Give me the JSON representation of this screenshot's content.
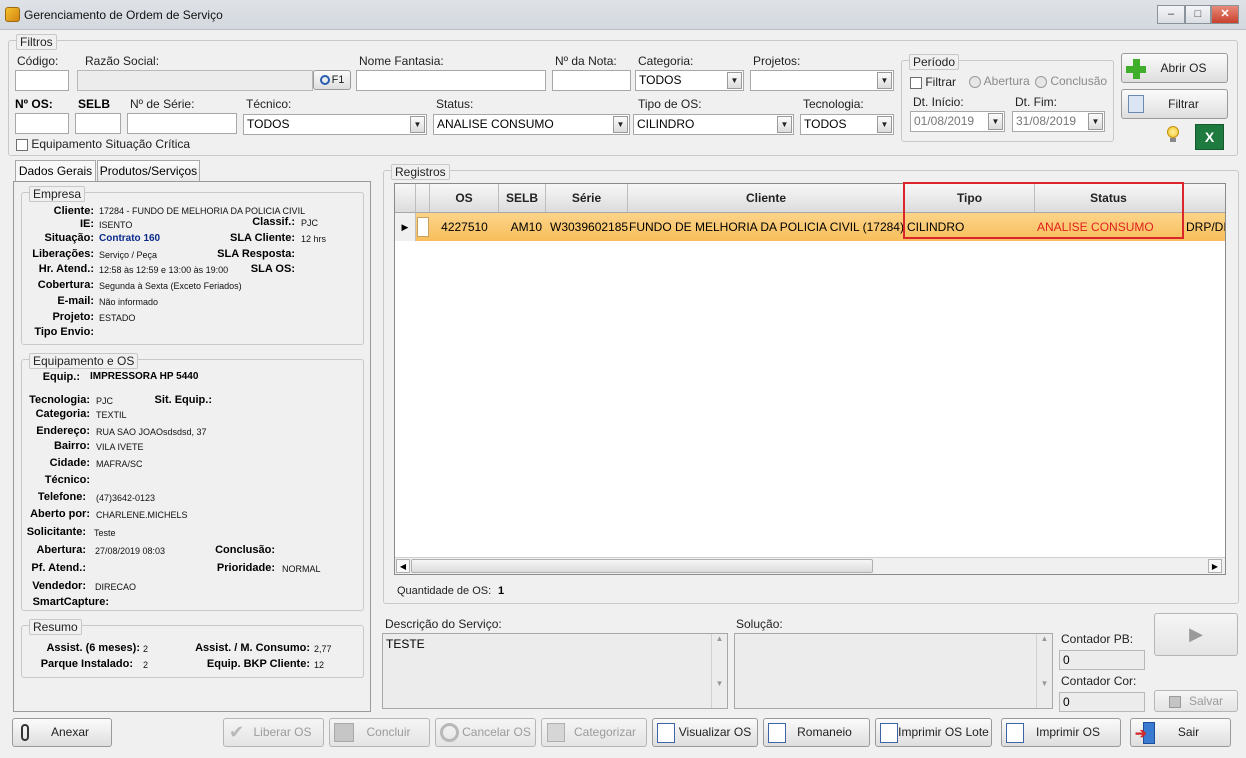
{
  "window": {
    "title": "Gerenciamento de Ordem de Serviço",
    "min": "–",
    "max": "□",
    "close": "✕"
  },
  "filtros": {
    "legend": "Filtros",
    "codigo_label": "Código:",
    "razao_label": "Razão Social:",
    "f1_label": "F1",
    "fantasia_label": "Nome Fantasia:",
    "nota_label": "Nº da Nota:",
    "categoria_label": "Categoria:",
    "categoria_value": "TODOS",
    "projetos_label": "Projetos:",
    "projetos_value": "",
    "os_label": "Nº OS:",
    "selb_label": "SELB",
    "serie_label": "Nº de Série:",
    "tecnico_label": "Técnico:",
    "tecnico_value": "TODOS",
    "status_label": "Status:",
    "status_value": "ANALISE CONSUMO",
    "tipo_label": "Tipo de OS:",
    "tipo_value": "CILINDRO",
    "tecnologia_label": "Tecnologia:",
    "tecnologia_value": "TODOS",
    "critica_label": "Equipamento Situação Crítica"
  },
  "periodo": {
    "legend": "Período",
    "filtrar_label": "Filtrar",
    "abertura_label": "Abertura",
    "conclusao_label": "Conclusão",
    "inicio_label": "Dt. Início:",
    "fim_label": "Dt. Fim:",
    "inicio_value": "01/08/2019",
    "fim_value": "31/08/2019"
  },
  "actions": {
    "abrir_os": "Abrir OS",
    "filtrar": "Filtrar"
  },
  "tabs": {
    "dados_gerais": "Dados Gerais",
    "produtos": "Produtos/Serviços"
  },
  "empresa": {
    "legend": "Empresa",
    "cliente_label": "Cliente:",
    "cliente_value": "17284 - FUNDO DE MELHORIA DA POLICIA CIVIL",
    "ie_label": "IE:",
    "ie_value": "ISENTO",
    "classif_label": "Classif.:",
    "classif_value": "PJC",
    "situacao_label": "Situação:",
    "situacao_value": "Contrato 160",
    "sla_cliente_label": "SLA Cliente:",
    "sla_cliente_value": "12 hrs",
    "liberacoes_label": "Liberações:",
    "liberacoes_value": "Serviço / Peça",
    "sla_resposta_label": "SLA Resposta:",
    "hr_atend_label": "Hr. Atend.:",
    "hr_atend_value": "12:58 às 12:59 e 13:00 às 19:00",
    "sla_os_label": "SLA OS:",
    "cobertura_label": "Cobertura:",
    "cobertura_value": "Segunda à Sexta (Exceto Feriados)",
    "email_label": "E-mail:",
    "email_value": "Não informado",
    "projeto_label": "Projeto:",
    "projeto_value": "ESTADO",
    "tipo_envio_label": "Tipo Envio:"
  },
  "equip": {
    "legend": "Equipamento e OS",
    "equip_label": "Equip.:",
    "equip_value": "IMPRESSORA HP 5440",
    "tecnologia_label": "Tecnologia:",
    "tecnologia_value": "PJC",
    "sit_label": "Sit. Equip.:",
    "categoria_label": "Categoria:",
    "categoria_value": "TEXTIL",
    "endereco_label": "Endereço:",
    "endereco_value": "RUA SAO JOAOsdsdsd, 37",
    "bairro_label": "Bairro:",
    "bairro_value": "VILA IVETE",
    "cidade_label": "Cidade:",
    "cidade_value": "MAFRA/SC",
    "tecnico_label": "Técnico:",
    "telefone_label": "Telefone:",
    "telefone_value": "(47)3642-0123",
    "aberto_label": "Aberto por:",
    "aberto_value": "CHARLENE.MICHELS",
    "solicitante_label": "Solicitante:",
    "solicitante_value": "Teste",
    "abertura_label": "Abertura:",
    "abertura_value": "27/08/2019 08:03",
    "conclusao_label": "Conclusão:",
    "pf_label": "Pf. Atend.:",
    "prioridade_label": "Prioridade:",
    "prioridade_value": "NORMAL",
    "vendedor_label": "Vendedor:",
    "vendedor_value": "DIRECAO",
    "smart_label": "SmartCapture:"
  },
  "resumo": {
    "legend": "Resumo",
    "assist_label": "Assist. (6 meses):",
    "assist_value": "2",
    "consumo_label": "Assist. / M. Consumo:",
    "consumo_value": "2,77",
    "parque_label": "Parque Instalado:",
    "parque_value": "2",
    "bkp_label": "Equip. BKP Cliente:",
    "bkp_value": "12"
  },
  "registros": {
    "legend": "Registros",
    "columns": {
      "os": "OS",
      "selb": "SELB",
      "serie": "Série",
      "cliente": "Cliente",
      "tipo": "Tipo",
      "status": "Status"
    },
    "row": {
      "os": "4227510",
      "selb": "AM10",
      "serie": "W3039602185",
      "cliente": "FUNDO DE MELHORIA DA POLICIA CIVIL (17284)",
      "tipo": "CILINDRO",
      "status": "ANALISE CONSUMO",
      "extra": "DRP/DIC"
    },
    "qtd_label": "Quantidade de OS:",
    "qtd_value": "1"
  },
  "descricao": {
    "label": "Descrição do Serviço:",
    "value": "TESTE"
  },
  "solucao": {
    "label": "Solução:",
    "value": ""
  },
  "contador": {
    "pb_label": "Contador PB:",
    "pb_value": "0",
    "cor_label": "Contador Cor:",
    "cor_value": "0",
    "salvar": "Salvar"
  },
  "footer": {
    "anexar": "Anexar",
    "liberar": "Liberar OS",
    "concluir": "Concluir",
    "cancelar": "Cancelar OS",
    "categorizar": "Categorizar",
    "visualizar": "Visualizar OS",
    "romaneio": "Romaneio",
    "imprimir_lote": "Imprimir OS Lote",
    "imprimir": "Imprimir OS",
    "sair": "Sair"
  },
  "colors": {
    "selected_row": "#fbc86c",
    "status_red": "#e02020",
    "highlight_box": "#d9252b",
    "link_blue": "#0a2a8c"
  }
}
